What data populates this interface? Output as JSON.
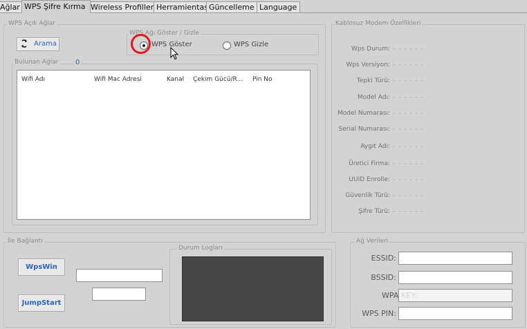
{
  "tabs": [
    "Ağlar",
    "WPS Şifre Kırma",
    "Wireless Profilleri",
    "Herramientas",
    "Güncelleme",
    "Language"
  ],
  "wps_panel": {
    "title": "WPS Açık Ağlar",
    "search_button": "Arama",
    "radio_group_title": "WPS Ağı Göster / Gizle",
    "radio_show": "WPS Göster",
    "radio_hide": "WPS Gizle",
    "found_label": "Bulunan Ağlar",
    "found_count": "0",
    "columns": [
      "Wifi Adı",
      "Wifi Mac Adresi",
      "Kanal",
      "Çekim Gücü/R...",
      "Pin No"
    ]
  },
  "modem_panel": {
    "title": "Kablosuz Modem Özellikleri",
    "fields": [
      {
        "label": "Wps Durum:",
        "value": "- - - - - -"
      },
      {
        "label": "Wps Versiyon:",
        "value": "- - - - - -"
      },
      {
        "label": "Tepki Türü:",
        "value": "- - - - - -"
      },
      {
        "label": "Model Adı:",
        "value": "- - - - - -"
      },
      {
        "label": "Model Numarası:",
        "value": "- - - - - -"
      },
      {
        "label": "Serial Numarası:",
        "value": "- - - - - -"
      },
      {
        "label": "Aygıt Adı:",
        "value": "- - - - - -"
      },
      {
        "label": "Üretici Firma:",
        "value": "- - - - - -"
      },
      {
        "label": "UUID Enrolle:",
        "value": "- - - - - -"
      },
      {
        "label": "Güvenlik Türü:",
        "value": "- - - - - -"
      },
      {
        "label": "Şifre Türü:",
        "value": "- - - - - -"
      }
    ]
  },
  "connect_panel": {
    "title": "İle Bağlantı",
    "wpswin_button": "WpsWin",
    "jumpstart_button": "JumpStart",
    "input1_value": "",
    "input2_value": ""
  },
  "log_panel": {
    "title": "Durum Logları"
  },
  "network_panel": {
    "title": "Ağ Verileri",
    "ssid_label": "ESSID:",
    "bssid_label": "BSSID:",
    "wpa_label": "WPA KEY:",
    "wps_pin_label": "WPS PIN:",
    "ssid_value": "",
    "bssid_value": "",
    "wpa_value": "",
    "wps_pin_value": ""
  },
  "colors": {
    "accent": "#2b62b8",
    "highlight_ring": "#e0191d",
    "log_bg": "#474747"
  },
  "icons": {
    "search": "refresh-arrows-icon",
    "cursor": "mouse-pointer-icon"
  }
}
